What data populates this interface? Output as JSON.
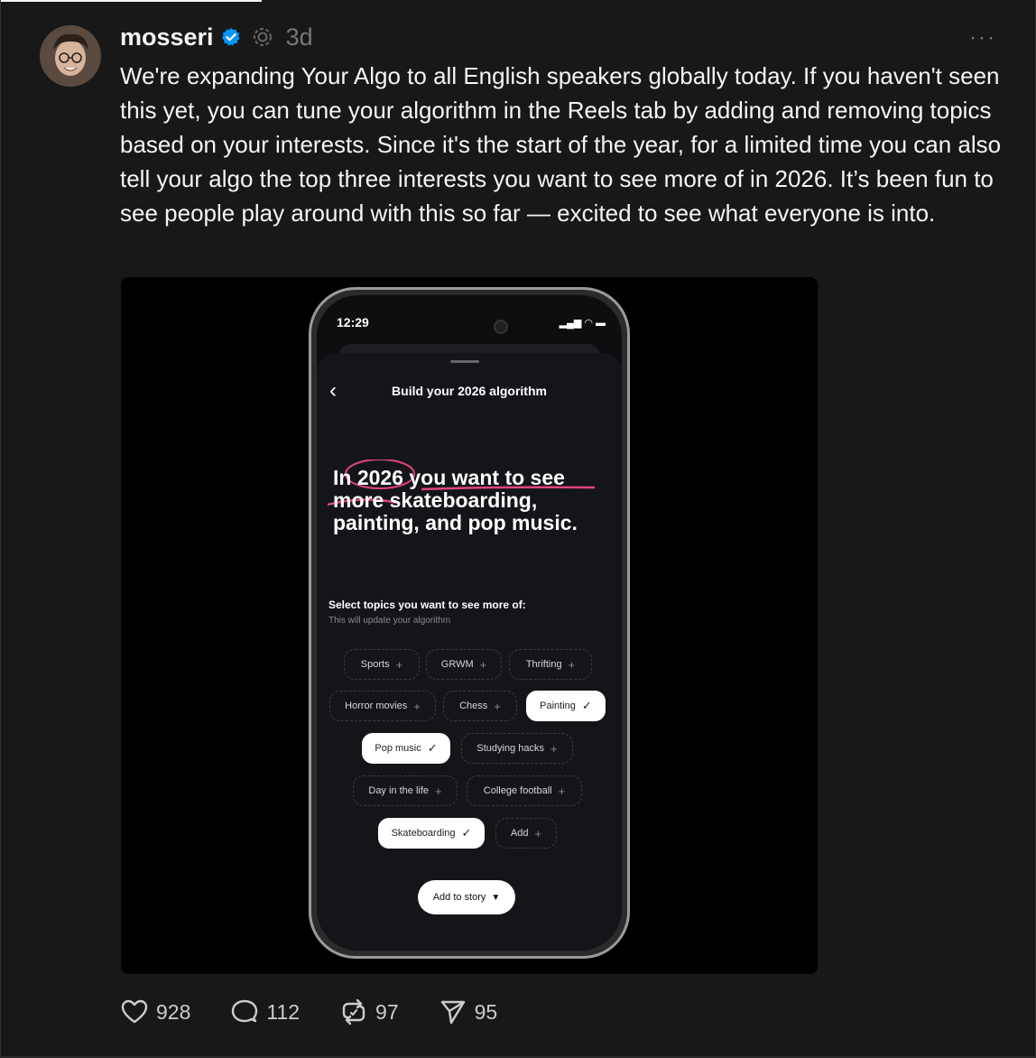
{
  "post": {
    "author": "mosseri",
    "time_ago": "3d",
    "more_label": "···",
    "text": "We're expanding Your Algo to all English speakers globally today. If you haven't seen this yet, you can tune your algorithm in the Reels tab by adding and removing topics based on your interests. Since it's the start of the year, for a limited time you can also tell your algo the top three interests you want to see more of in 2026. It’s been fun to see people play around with this so far — excited to see what everyone is into."
  },
  "phone": {
    "status_time": "12:29",
    "sheet_title": "Build your 2026 algorithm",
    "headline": "In 2026 you want to see more skateboarding, painting, and pop music.",
    "select_title": "Select topics you want to see more of:",
    "select_subtitle": "This will update your algorithm",
    "chips": [
      {
        "label": "Sports",
        "selected": false
      },
      {
        "label": "GRWM",
        "selected": false
      },
      {
        "label": "Thrifting",
        "selected": false
      },
      {
        "label": "Horror movies",
        "selected": false
      },
      {
        "label": "Chess",
        "selected": false
      },
      {
        "label": "Painting",
        "selected": true
      },
      {
        "label": "Pop music",
        "selected": true
      },
      {
        "label": "Studying hacks",
        "selected": false
      },
      {
        "label": "Day in the life",
        "selected": false
      },
      {
        "label": "College football",
        "selected": false
      },
      {
        "label": "Skateboarding",
        "selected": true
      },
      {
        "label": "Add",
        "selected": false
      }
    ],
    "add_to_story": "Add to story"
  },
  "actions": {
    "likes": "928",
    "comments": "112",
    "reposts": "97",
    "shares": "95"
  },
  "icons": {
    "verified": "verified-badge-icon",
    "threads": "threads-meta-icon",
    "like": "heart-icon",
    "comment": "comment-icon",
    "repost": "repost-icon",
    "share": "send-icon"
  },
  "colors": {
    "background": "#181818",
    "verified": "#0095f6",
    "accent_pink": "#e0457b"
  }
}
